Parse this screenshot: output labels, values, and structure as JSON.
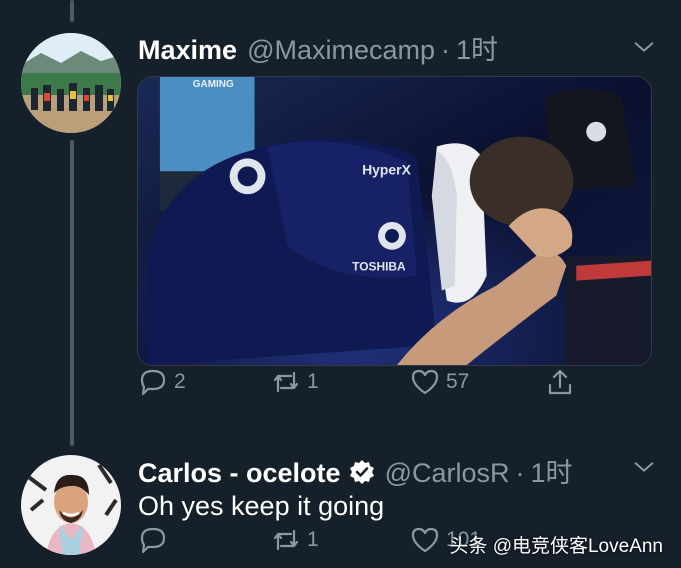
{
  "tweets": [
    {
      "name": "Maxime",
      "handle": "@Maximecamp",
      "separator": "·",
      "time": "1时",
      "avatar_icon": "avatar-group-photo",
      "media": {
        "icon": "media-photo",
        "jersey_brand": "HyperX",
        "jersey_sponsor": "TOSHIBA",
        "banner_fragment": "GAMING"
      },
      "stats": {
        "replies": "2",
        "retweets": "1",
        "likes": "57"
      }
    },
    {
      "name": "Carlos - ocelote",
      "verified": true,
      "handle": "@CarlosR",
      "separator": "·",
      "time": "1时",
      "avatar_icon": "avatar-portrait",
      "text": "Oh yes keep it going",
      "stats": {
        "replies": "",
        "retweets": "1",
        "likes": "101"
      }
    }
  ],
  "watermark": "头条 @电竞侠客LoveAnn",
  "colors": {
    "background": "#15202b",
    "muted": "#8899a6",
    "text": "#ffffff",
    "thread": "#4b5a67"
  }
}
